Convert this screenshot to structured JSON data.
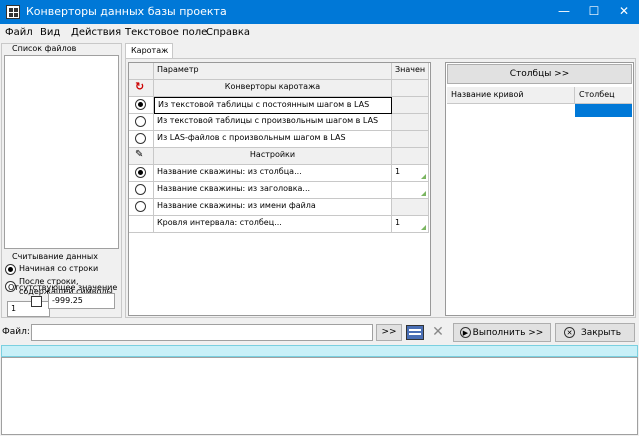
{
  "window": {
    "title": "Конверторы данных базы проекта",
    "minimize": "—",
    "maximize": "☐",
    "close": "✕"
  },
  "menu": [
    "Файл",
    "Вид",
    "Действия",
    "Текстовое поле",
    "Справка"
  ],
  "left_panel": {
    "files_title": "Список файлов",
    "reading_title": "Считывание данных",
    "radio_start": "Начиная со строки",
    "radio_after_line1": "После строки,",
    "radio_after_line2": "содержащей символы",
    "start_row_value": "1",
    "missing_title": "Отсутствующее значение",
    "missing_value": "-999.25"
  },
  "tab": "Каротаж",
  "grid": {
    "col_param": "Параметр",
    "col_value": "Значен",
    "group1": "Конверторы каротажа",
    "rows1": [
      "Из текстовой таблицы с постоянным шагом в LAS",
      "Из текстовой таблицы с произвольным шагом в LAS",
      "Из LAS-файлов с произвольным шагом в LAS"
    ],
    "group2": "Настройки",
    "rows2": [
      {
        "label": "Название скважины: из столбца...",
        "value": "1"
      },
      {
        "label": "Название скважины: из заголовка...",
        "value": ""
      },
      {
        "label": "Название скважины: из имени файла",
        "value": ""
      },
      {
        "label": "Кровля интервала: столбец...",
        "value": "1"
      }
    ]
  },
  "right_panel": {
    "columns_button": "Столбцы >>",
    "col_curve": "Название кривой",
    "col_column": "Столбец"
  },
  "bottom": {
    "file_label": "Файл:",
    "file_value": "",
    "browse_label": ">>",
    "run_label": "Выполнить >>",
    "close_label": "Закрыть"
  }
}
